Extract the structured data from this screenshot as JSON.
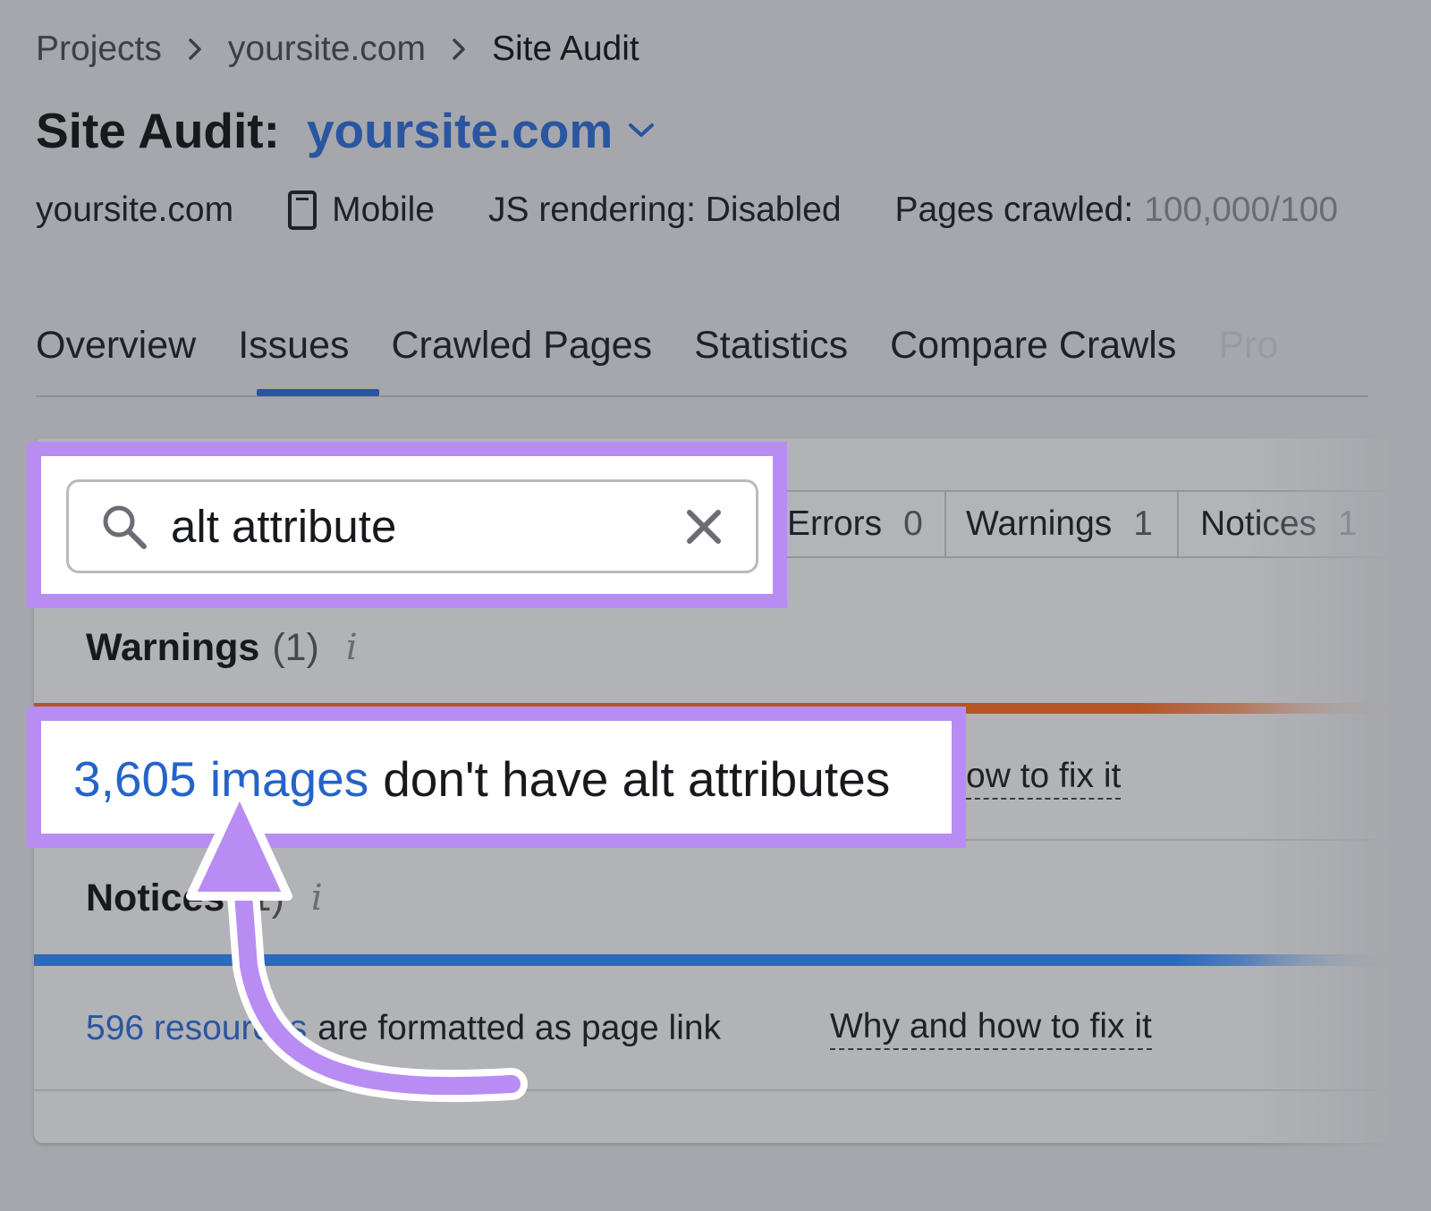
{
  "breadcrumb": [
    "Projects",
    "yoursite.com",
    "Site Audit"
  ],
  "title": {
    "prefix": "Site Audit:",
    "domain": "yoursite.com"
  },
  "meta": {
    "domain": "yoursite.com",
    "device": "Mobile",
    "js_rendering": "JS rendering: Disabled",
    "pages_label": "Pages crawled:",
    "pages_value": "100,000/100"
  },
  "tabs": [
    {
      "label": "Overview"
    },
    {
      "label": "Issues",
      "active": true
    },
    {
      "label": "Crawled Pages"
    },
    {
      "label": "Statistics"
    },
    {
      "label": "Compare Crawls"
    },
    {
      "label": "Pro"
    }
  ],
  "search": {
    "value": "alt attribute"
  },
  "filters": [
    {
      "label": "Errors",
      "count": "0"
    },
    {
      "label": "Warnings",
      "count": "1"
    },
    {
      "label": "Notices",
      "count": "1"
    }
  ],
  "warnings": {
    "title": "Warnings",
    "count": "(1)",
    "issue": {
      "link": "3,605 images",
      "text": "don't have alt attributes",
      "fix_partial": "ow to fix it"
    }
  },
  "notices": {
    "title": "Notices",
    "count": "(1)",
    "issue": {
      "link": "596 resources",
      "text": "are formatted as page link",
      "fix": "Why and how to fix it"
    }
  },
  "colors": {
    "accent": "#2a55a0",
    "highlight": "#b98cf4",
    "warning_bar": "#b65426",
    "notice_bar": "#2d6ab8"
  }
}
